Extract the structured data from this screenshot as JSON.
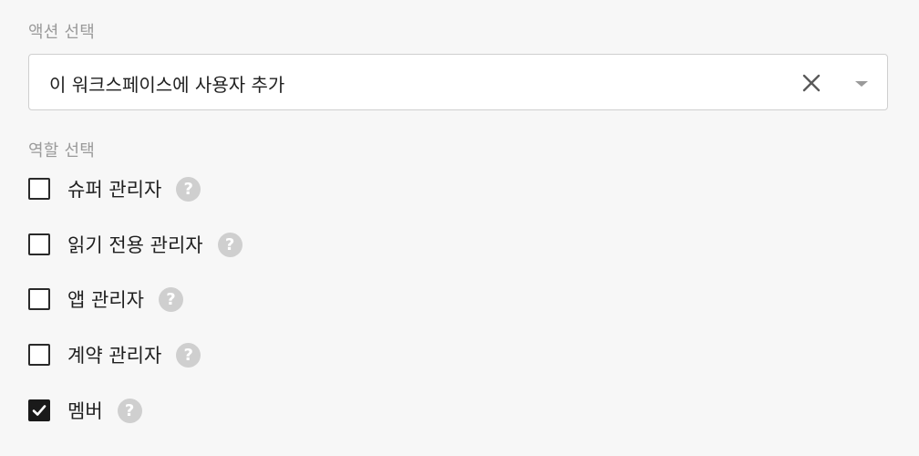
{
  "action": {
    "label": "액션 선택",
    "selected_value": "이 워크스페이스에 사용자 추가",
    "clear_icon": "close-icon",
    "dropdown_icon": "caret-down-icon"
  },
  "roles": {
    "label": "역할 선택",
    "help_glyph": "?",
    "items": [
      {
        "label": "슈퍼 관리자",
        "checked": false
      },
      {
        "label": "읽기 전용 관리자",
        "checked": false
      },
      {
        "label": "앱 관리자",
        "checked": false
      },
      {
        "label": "계약 관리자",
        "checked": false
      },
      {
        "label": "멤버",
        "checked": true
      }
    ]
  },
  "colors": {
    "background": "#f7f7f7",
    "muted_label": "#9a9a9a",
    "checkbox_checked": "#1a1a1a",
    "help_icon_bg": "#cfcfcf"
  }
}
